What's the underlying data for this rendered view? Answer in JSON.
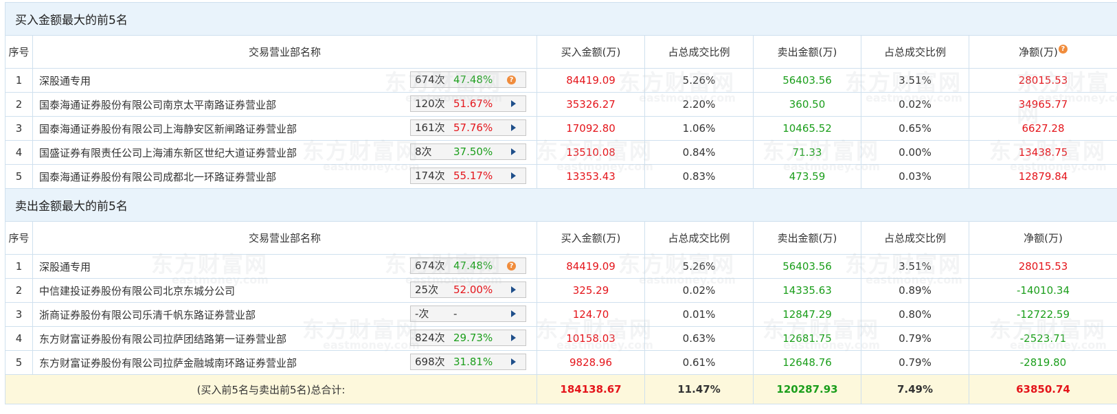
{
  "watermark": {
    "cn": "东方财富网",
    "en": "eastmoney.com"
  },
  "headers": [
    "序号",
    "交易营业部名称",
    "买入金额(万)",
    "占总成交比例",
    "卖出金额(万)",
    "占总成交比例",
    "净额(万)"
  ],
  "buy_section": {
    "title": "买入金额最大的前5名",
    "rows": [
      {
        "no": "1",
        "name": "深股通专用",
        "times": "674次",
        "pct": "47.48%",
        "pct_color": "green",
        "icon": "question-icon",
        "buy": "84419.09",
        "buy_ratio": "5.26%",
        "sell": "56403.56",
        "sell_ratio": "3.51%",
        "net": "28015.53",
        "net_color": "red"
      },
      {
        "no": "2",
        "name": "国泰海通证券股份有限公司南京太平南路证券营业部",
        "times": "120次",
        "pct": "51.67%",
        "pct_color": "red",
        "icon": "arrow-right-icon",
        "buy": "35326.27",
        "buy_ratio": "2.20%",
        "sell": "360.50",
        "sell_ratio": "0.02%",
        "net": "34965.77",
        "net_color": "red"
      },
      {
        "no": "3",
        "name": "国泰海通证券股份有限公司上海静安区新闸路证券营业部",
        "times": "161次",
        "pct": "57.76%",
        "pct_color": "red",
        "icon": "arrow-right-icon",
        "buy": "17092.80",
        "buy_ratio": "1.06%",
        "sell": "10465.52",
        "sell_ratio": "0.65%",
        "net": "6627.28",
        "net_color": "red"
      },
      {
        "no": "4",
        "name": "国盛证券有限责任公司上海浦东新区世纪大道证券营业部",
        "times": "8次",
        "pct": "37.50%",
        "pct_color": "green",
        "icon": "arrow-right-icon",
        "buy": "13510.08",
        "buy_ratio": "0.84%",
        "sell": "71.33",
        "sell_ratio": "0.00%",
        "net": "13438.75",
        "net_color": "red"
      },
      {
        "no": "5",
        "name": "国泰海通证券股份有限公司成都北一环路证券营业部",
        "times": "174次",
        "pct": "55.17%",
        "pct_color": "red",
        "icon": "arrow-right-icon",
        "buy": "13353.43",
        "buy_ratio": "0.83%",
        "sell": "473.59",
        "sell_ratio": "0.03%",
        "net": "12879.84",
        "net_color": "red"
      }
    ]
  },
  "sell_section": {
    "title": "卖出金额最大的前5名",
    "rows": [
      {
        "no": "1",
        "name": "深股通专用",
        "times": "674次",
        "pct": "47.48%",
        "pct_color": "green",
        "icon": "question-icon",
        "buy": "84419.09",
        "buy_ratio": "5.26%",
        "sell": "56403.56",
        "sell_ratio": "3.51%",
        "net": "28015.53",
        "net_color": "red"
      },
      {
        "no": "2",
        "name": "中信建投证券股份有限公司北京东城分公司",
        "times": "25次",
        "pct": "52.00%",
        "pct_color": "red",
        "icon": "arrow-right-icon",
        "buy": "325.29",
        "buy_ratio": "0.02%",
        "sell": "14335.63",
        "sell_ratio": "0.89%",
        "net": "-14010.34",
        "net_color": "green"
      },
      {
        "no": "3",
        "name": "浙商证券股份有限公司乐清千帆东路证券营业部",
        "times": "-次",
        "pct": "-",
        "pct_color": "dark",
        "icon": "arrow-right-icon",
        "buy": "124.70",
        "buy_ratio": "0.01%",
        "sell": "12847.29",
        "sell_ratio": "0.80%",
        "net": "-12722.59",
        "net_color": "green"
      },
      {
        "no": "4",
        "name": "东方财富证券股份有限公司拉萨团结路第一证券营业部",
        "times": "824次",
        "pct": "29.73%",
        "pct_color": "green",
        "icon": "arrow-right-icon",
        "buy": "10158.03",
        "buy_ratio": "0.63%",
        "sell": "12681.75",
        "sell_ratio": "0.79%",
        "net": "-2523.71",
        "net_color": "green"
      },
      {
        "no": "5",
        "name": "东方财富证券股份有限公司拉萨金融城南环路证券营业部",
        "times": "698次",
        "pct": "31.81%",
        "pct_color": "green",
        "icon": "arrow-right-icon",
        "buy": "9828.96",
        "buy_ratio": "0.61%",
        "sell": "12648.76",
        "sell_ratio": "0.79%",
        "net": "-2819.80",
        "net_color": "green"
      }
    ]
  },
  "total": {
    "label": "(买入前5名与卖出前5名)总合计:",
    "buy": "184138.67",
    "buy_ratio": "11.47%",
    "sell": "120287.93",
    "sell_ratio": "7.49%",
    "net": "63850.74"
  },
  "colors": {
    "red": "#e4151b",
    "green": "#1b9e1b",
    "header_bg": "#e9f3fb",
    "border": "#cfe0ee",
    "total_bg": "#fdf8dc"
  }
}
